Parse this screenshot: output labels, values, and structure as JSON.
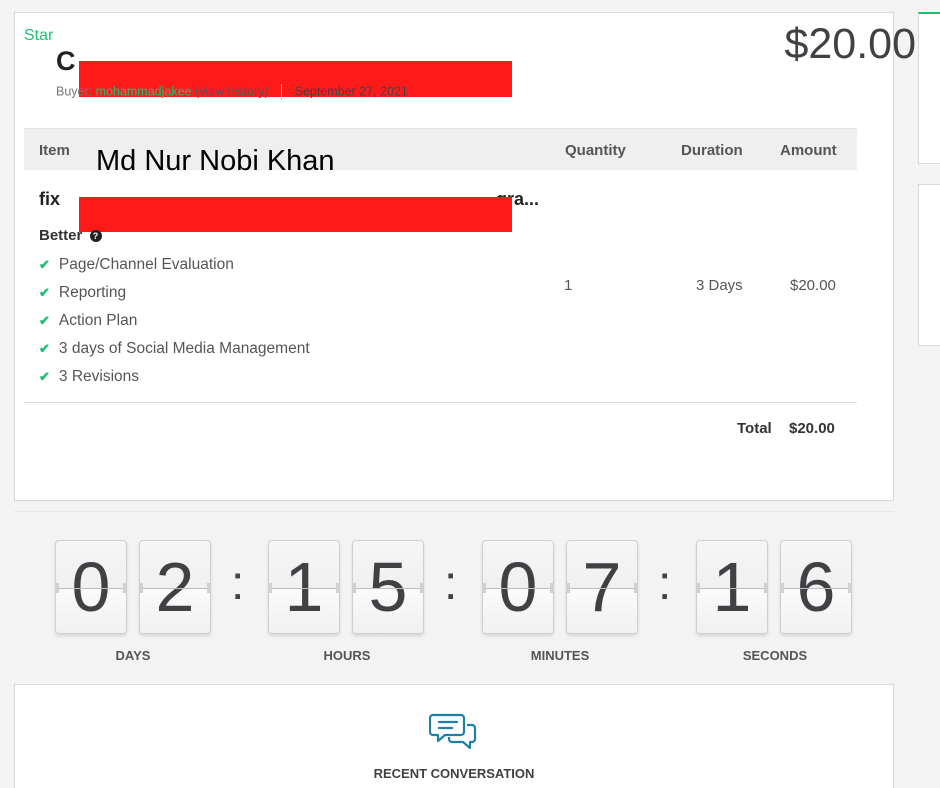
{
  "order": {
    "level_label": "Star",
    "title_visible_initial": "C",
    "buyer_prefix": "Buyer:",
    "buyer_name": "mohammadjakee",
    "view_history": "(view history)",
    "date": "September 27, 2021",
    "price": "$20.00"
  },
  "table": {
    "headers": {
      "item": "Item",
      "quantity": "Quantity",
      "duration": "Duration",
      "amount": "Amount"
    },
    "row": {
      "title_start": "fix",
      "title_end": "gra...",
      "package": "Better",
      "features": [
        "Page/Channel Evaluation",
        "Reporting",
        "Action Plan",
        "3 days of Social Media Management",
        "3 Revisions"
      ],
      "quantity": "1",
      "duration": "3 Days",
      "amount": "$20.00"
    },
    "total_label": "Total",
    "total_value": "$20.00"
  },
  "overlay_text": "Md Nur Nobi Khan",
  "countdown": {
    "digits": [
      "0",
      "2",
      "1",
      "5",
      "0",
      "7",
      "1",
      "6"
    ],
    "separator": ":",
    "labels": [
      "DAYS",
      "HOURS",
      "MINUTES",
      "SECONDS"
    ]
  },
  "conversation": {
    "label": "RECENT CONVERSATION",
    "icon": "chat-bubbles-icon"
  },
  "colors": {
    "accent_green": "#1dbf73",
    "redaction_red": "#ff1a1a",
    "text_dark": "#404145"
  }
}
